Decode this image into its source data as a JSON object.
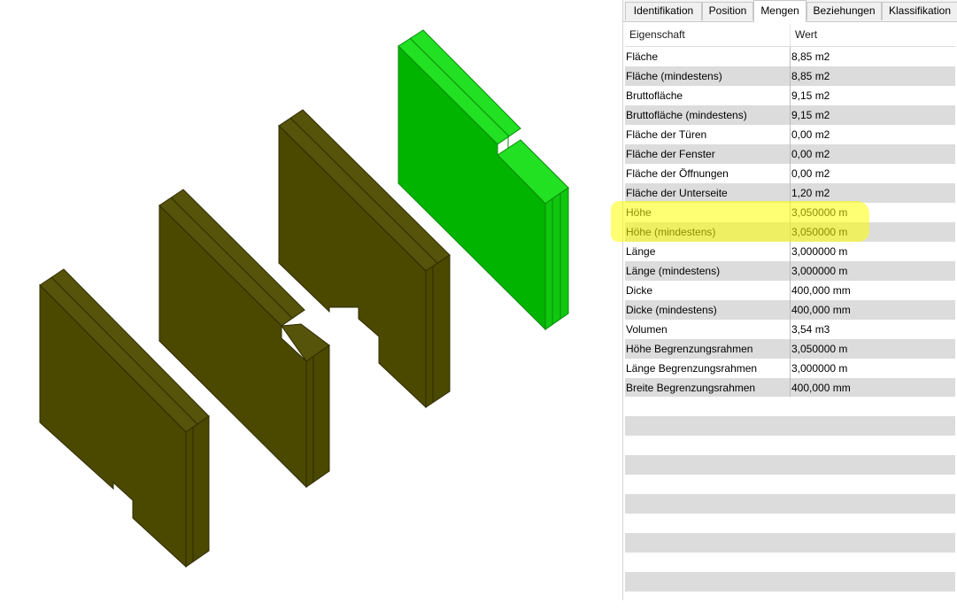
{
  "tabs": [
    {
      "label": "Identifikation"
    },
    {
      "label": "Position"
    },
    {
      "label": "Mengen"
    },
    {
      "label": "Beziehungen"
    },
    {
      "label": "Klassifikation"
    }
  ],
  "active_tab": "Mengen",
  "grid": {
    "headers": {
      "property": "Eigenschaft",
      "value": "Wert"
    },
    "rows": [
      {
        "property": "Fläche",
        "value": "8,85 m2"
      },
      {
        "property": "Fläche (mindestens)",
        "value": "8,85 m2"
      },
      {
        "property": "Bruttofläche",
        "value": "9,15 m2"
      },
      {
        "property": "Bruttofläche (mindestens)",
        "value": "9,15 m2"
      },
      {
        "property": "Fläche der Türen",
        "value": "0,00 m2"
      },
      {
        "property": "Fläche der Fenster",
        "value": "0,00 m2"
      },
      {
        "property": "Fläche der Öffnungen",
        "value": "0,00 m2"
      },
      {
        "property": "Fläche der Unterseite",
        "value": "1,20 m2"
      },
      {
        "property": "Höhe",
        "value": "3,050000 m"
      },
      {
        "property": "Höhe (mindestens)",
        "value": "3,050000 m"
      },
      {
        "property": "Länge",
        "value": "3,000000 m"
      },
      {
        "property": "Länge (mindestens)",
        "value": "3,000000 m"
      },
      {
        "property": "Dicke",
        "value": "400,000 mm"
      },
      {
        "property": "Dicke (mindestens)",
        "value": "400,000 mm"
      },
      {
        "property": "Volumen",
        "value": "3,54 m3"
      },
      {
        "property": "Höhe Begrenzungsrahmen",
        "value": "3,050000 m"
      },
      {
        "property": "Länge Begrenzungsrahmen",
        "value": "3,000000 m"
      },
      {
        "property": "Breite Begrenzungsrahmen",
        "value": "400,000 mm"
      }
    ]
  },
  "colors": {
    "wall": "#4b4800",
    "wall_selected": "#00b400",
    "highlight": "#ffff00"
  }
}
